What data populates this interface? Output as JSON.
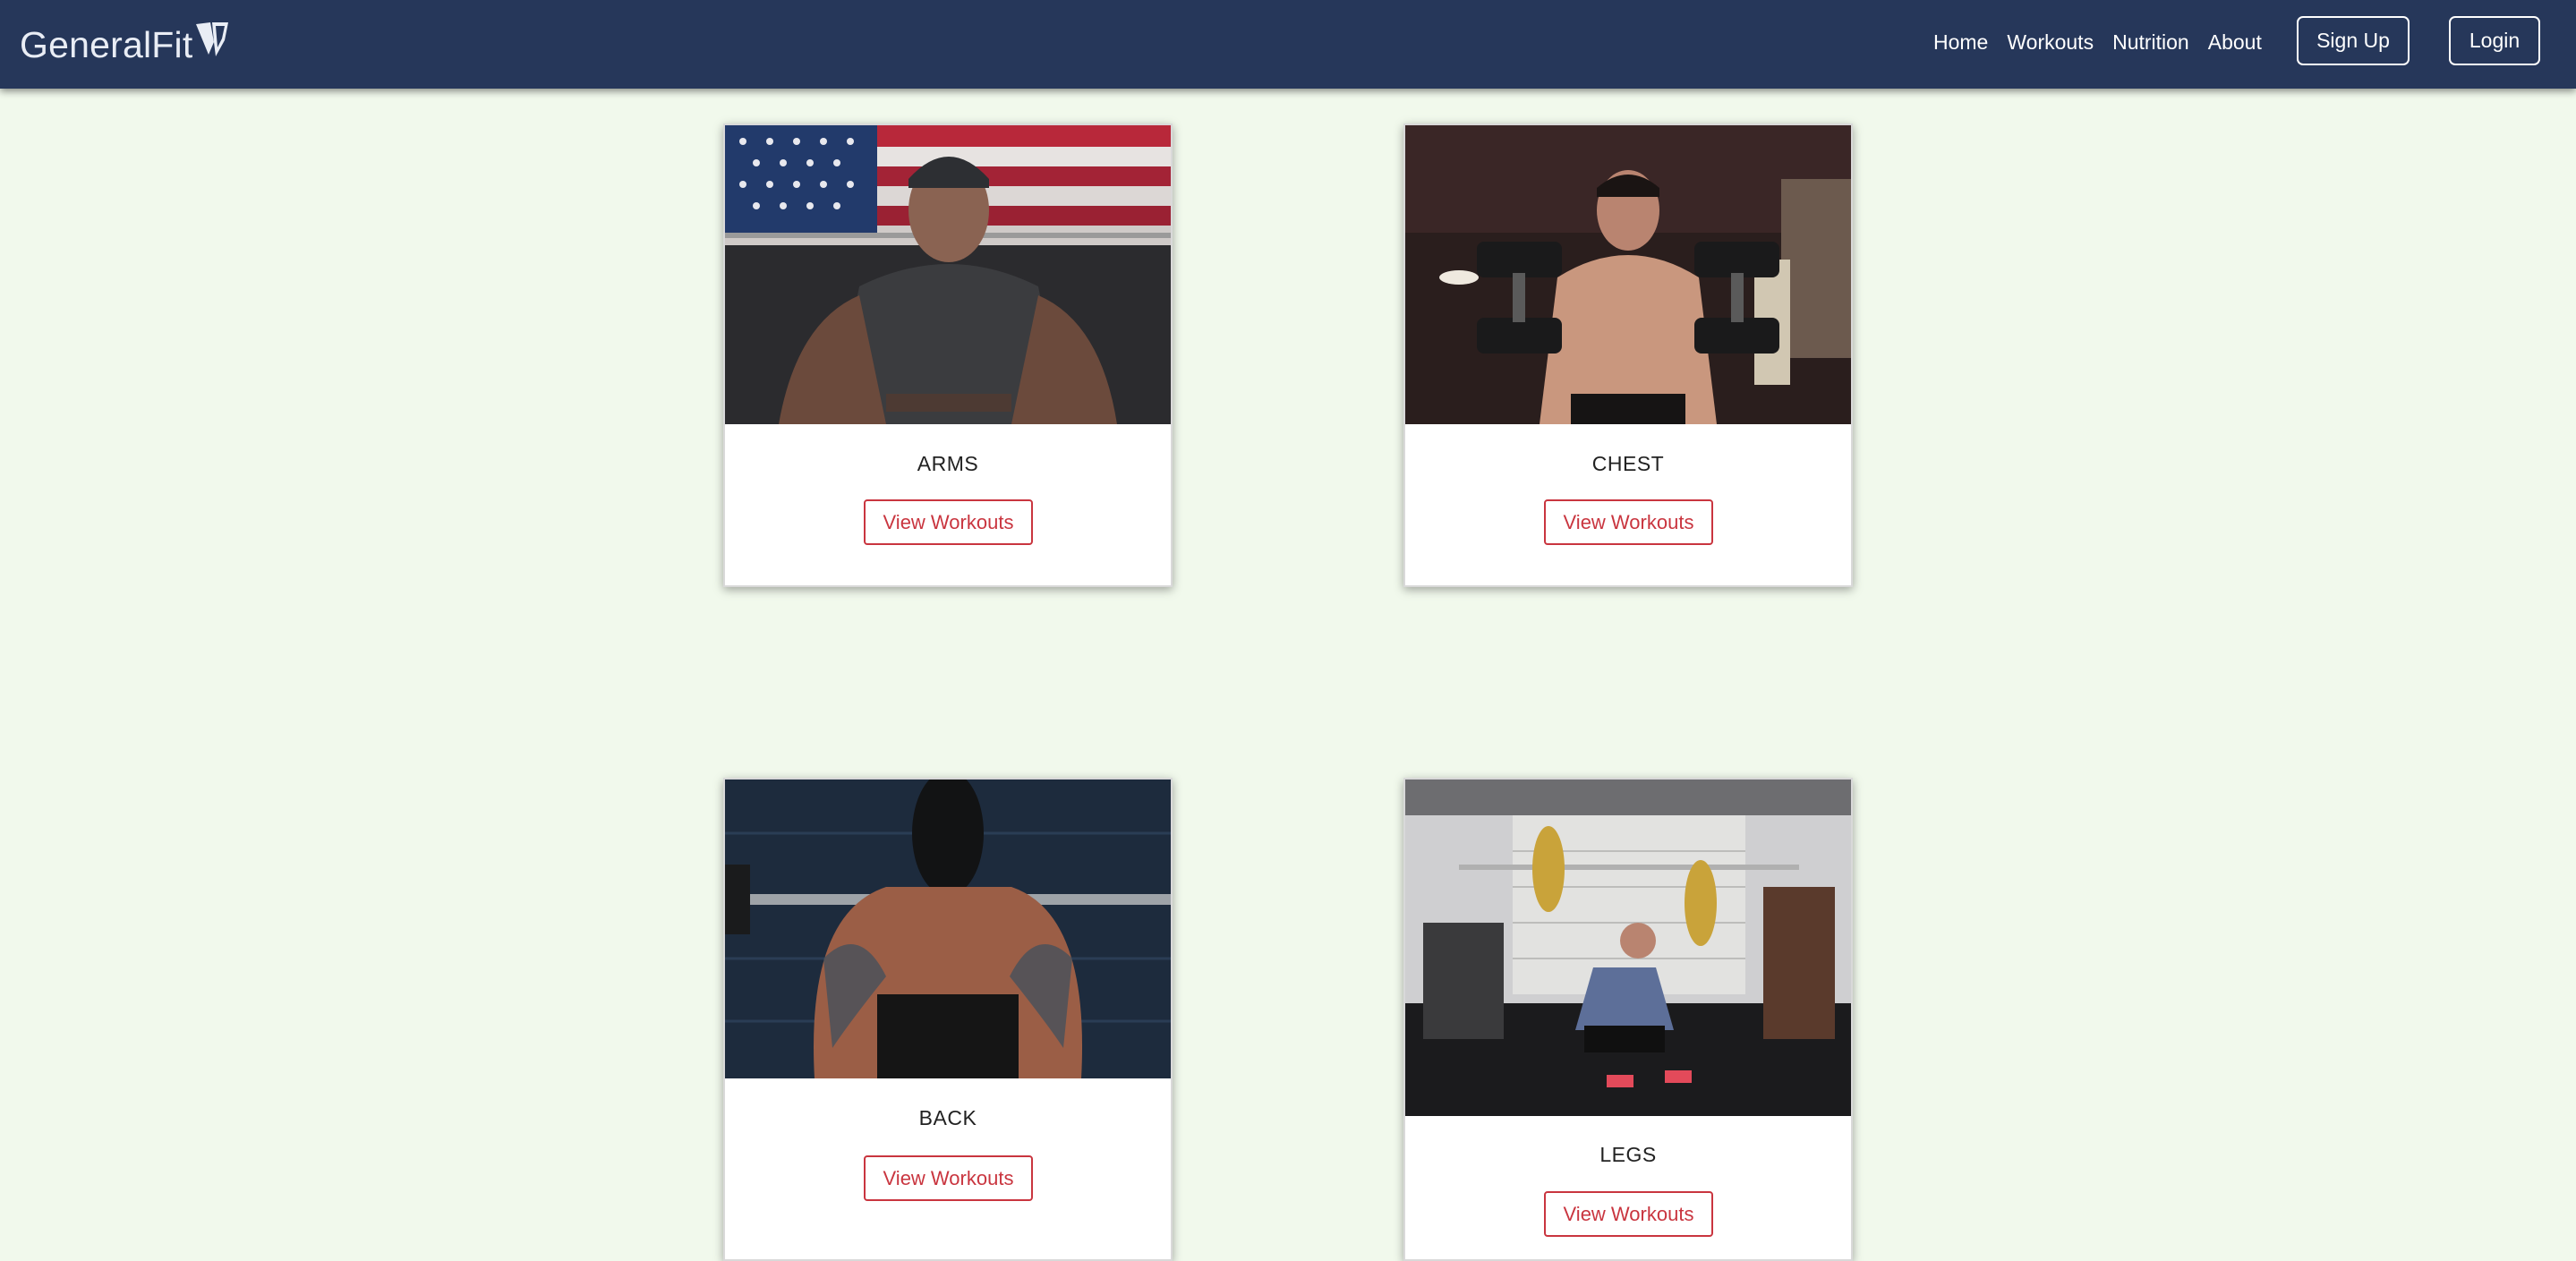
{
  "brand": {
    "name": "GeneralFit"
  },
  "nav": {
    "links": [
      "Home",
      "Workouts",
      "Nutrition",
      "About"
    ],
    "signup_label": "Sign Up",
    "login_label": "Login"
  },
  "cards": [
    {
      "title": "ARMS",
      "button_label": "View Workouts"
    },
    {
      "title": "CHEST",
      "button_label": "View Workouts"
    },
    {
      "title": "BACK",
      "button_label": "View Workouts"
    },
    {
      "title": "LEGS",
      "button_label": "View Workouts"
    }
  ],
  "colors": {
    "navbar": "#26375a",
    "page_background": "#f1f9ec",
    "accent": "#c9353f"
  }
}
